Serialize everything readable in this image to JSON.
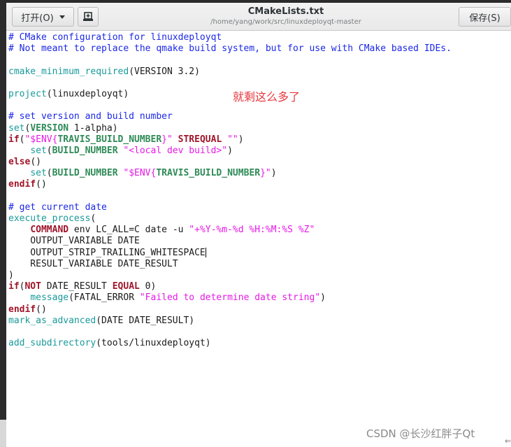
{
  "window": {
    "title": "CMakeLists.txt",
    "path": "/home/yang/work/src/linuxdeployqt-master"
  },
  "toolbar": {
    "open_label": "打开(O)",
    "open_dropdown_icon": "chevron-down-icon",
    "new_document_icon": "new-document-icon",
    "save_label": "保存(S)"
  },
  "editor": {
    "lines": [
      [
        {
          "t": "# CMake configuration for linuxdeployqt",
          "c": "cm"
        }
      ],
      [
        {
          "t": "# Not meant to replace the qmake build system, but for use with CMake based IDEs.",
          "c": "cm"
        }
      ],
      [],
      [
        {
          "t": "cmake_minimum_required",
          "c": "fn"
        },
        {
          "t": "(VERSION 3.2)",
          "c": ""
        }
      ],
      [],
      [
        {
          "t": "project",
          "c": "fn"
        },
        {
          "t": "(linuxdeployqt)",
          "c": ""
        }
      ],
      [],
      [
        {
          "t": "# set version and build number",
          "c": "cm"
        }
      ],
      [
        {
          "t": "set",
          "c": "fn"
        },
        {
          "t": "(",
          "c": ""
        },
        {
          "t": "VERSION",
          "c": "arg"
        },
        {
          "t": " 1-alpha)",
          "c": ""
        }
      ],
      [
        {
          "t": "if",
          "c": "kw"
        },
        {
          "t": "(",
          "c": ""
        },
        {
          "t": "\"$ENV{",
          "c": "str"
        },
        {
          "t": "TRAVIS_BUILD_NUMBER",
          "c": "arg"
        },
        {
          "t": "}\"",
          "c": "str"
        },
        {
          "t": " ",
          "c": ""
        },
        {
          "t": "STREQUAL",
          "c": "kw"
        },
        {
          "t": " ",
          "c": ""
        },
        {
          "t": "\"\"",
          "c": "str"
        },
        {
          "t": ")",
          "c": ""
        }
      ],
      [
        {
          "t": "    ",
          "c": ""
        },
        {
          "t": "set",
          "c": "fn"
        },
        {
          "t": "(",
          "c": ""
        },
        {
          "t": "BUILD_NUMBER",
          "c": "arg"
        },
        {
          "t": " ",
          "c": ""
        },
        {
          "t": "\"<local dev build>\"",
          "c": "str"
        },
        {
          "t": ")",
          "c": ""
        }
      ],
      [
        {
          "t": "else",
          "c": "kw"
        },
        {
          "t": "()",
          "c": ""
        }
      ],
      [
        {
          "t": "    ",
          "c": ""
        },
        {
          "t": "set",
          "c": "fn"
        },
        {
          "t": "(",
          "c": ""
        },
        {
          "t": "BUILD_NUMBER",
          "c": "arg"
        },
        {
          "t": " ",
          "c": ""
        },
        {
          "t": "\"$ENV{",
          "c": "str"
        },
        {
          "t": "TRAVIS_BUILD_NUMBER",
          "c": "arg"
        },
        {
          "t": "}\"",
          "c": "str"
        },
        {
          "t": ")",
          "c": ""
        }
      ],
      [
        {
          "t": "endif",
          "c": "kw"
        },
        {
          "t": "()",
          "c": ""
        }
      ],
      [],
      [
        {
          "t": "# get current date",
          "c": "cm"
        }
      ],
      [
        {
          "t": "execute_process",
          "c": "fn"
        },
        {
          "t": "(",
          "c": ""
        }
      ],
      [
        {
          "t": "    ",
          "c": ""
        },
        {
          "t": "COMMAND",
          "c": "kw"
        },
        {
          "t": " env LC_ALL=C date -u ",
          "c": ""
        },
        {
          "t": "\"+%Y-%m-%d %H:%M:%S %Z\"",
          "c": "str"
        }
      ],
      [
        {
          "t": "    OUTPUT_VARIABLE DATE",
          "c": ""
        }
      ],
      [
        {
          "t": "    OUTPUT_STRIP_TRAILING_WHITESPACE",
          "c": ""
        },
        {
          "t": "",
          "c": "cursor"
        }
      ],
      [
        {
          "t": "    RESULT_VARIABLE DATE_RESULT",
          "c": ""
        }
      ],
      [
        {
          "t": ")",
          "c": ""
        }
      ],
      [
        {
          "t": "if",
          "c": "kw"
        },
        {
          "t": "(",
          "c": ""
        },
        {
          "t": "NOT",
          "c": "kw"
        },
        {
          "t": " DATE_RESULT ",
          "c": ""
        },
        {
          "t": "EQUAL",
          "c": "kw"
        },
        {
          "t": " 0)",
          "c": ""
        }
      ],
      [
        {
          "t": "    ",
          "c": ""
        },
        {
          "t": "message",
          "c": "fn"
        },
        {
          "t": "(FATAL_ERROR ",
          "c": ""
        },
        {
          "t": "\"Failed to determine date string\"",
          "c": "str"
        },
        {
          "t": ")",
          "c": ""
        }
      ],
      [
        {
          "t": "endif",
          "c": "kw"
        },
        {
          "t": "()",
          "c": ""
        }
      ],
      [
        {
          "t": "mark_as_advanced",
          "c": "fn"
        },
        {
          "t": "(DATE DATE_RESULT)",
          "c": ""
        }
      ],
      [],
      [
        {
          "t": "add_subdirectory",
          "c": "fn"
        },
        {
          "t": "(tools/linuxdeployqt)",
          "c": ""
        }
      ]
    ]
  },
  "annotation": "就剩这么多了",
  "watermark": "CSDN @长沙红胖子Qt",
  "corner_glyph": "⇐"
}
